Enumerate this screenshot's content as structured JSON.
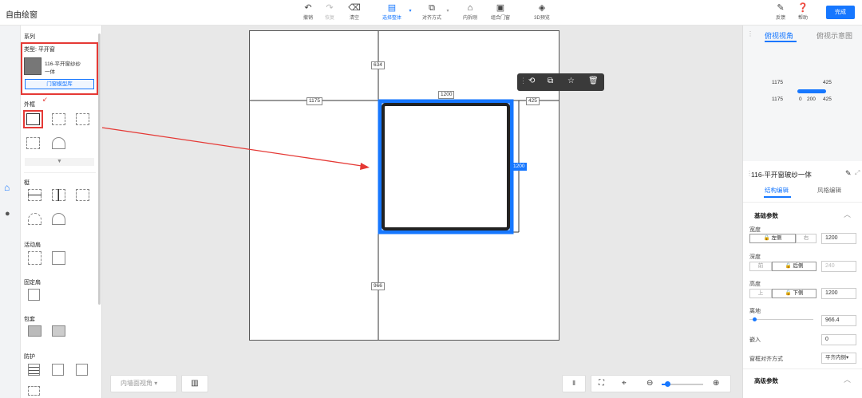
{
  "app": {
    "title": "自由绘窗"
  },
  "toolbar": {
    "undo": "撤销",
    "redo": "恢复",
    "clear": "清空",
    "select_all": "选择整体",
    "align": "对齐方式",
    "inner_split": "内拆刚",
    "combine": "组合门窗",
    "preview3d": "3D预览",
    "feedback": "反馈",
    "help": "帮助",
    "done": "完成"
  },
  "left_panel": {
    "series_title": "系列",
    "type_label": "类型: 平开窗",
    "product_name_1": "116-平开窗纱纱",
    "product_name_2": "一体",
    "library_button": "门窗模型库",
    "section_frame": "外框",
    "section_mullion": "梃",
    "section_active_sash": "活动扇",
    "section_fixed_sash": "固定扇",
    "section_cover": "包套",
    "section_guard": "防护"
  },
  "drawing": {
    "dim_top": "634",
    "dim_left": "1175",
    "dim_width": "1200",
    "dim_right": "425",
    "dim_height": "1200",
    "dim_bottom": "966"
  },
  "canvas_bottom": {
    "view_select": "内墙面视角"
  },
  "right_panel": {
    "tab_top_view": "俯视视角",
    "tab_top_diagram": "俯视示意图",
    "mini_left_1": "1175",
    "mini_right_1": "425",
    "mini_left_2": "1175",
    "mini_mid_0": "0",
    "mini_mid_200": "200",
    "mini_right_2": "425",
    "product_title": "116-平开窗玻纱一体",
    "tab_structure": "结构编辑",
    "tab_style": "风格编辑",
    "basic_params": "基础参数",
    "width_label": "宽度",
    "width_left": "左侧",
    "width_right": "右",
    "width_value": "1200",
    "depth_label": "深度",
    "depth_front": "前",
    "depth_back": "后侧",
    "depth_value": "240",
    "height_label": "高度",
    "height_up": "上",
    "height_down": "下侧",
    "height_value": "1200",
    "ground_label": "离地",
    "ground_value": "966.4",
    "embed_label": "嵌入",
    "embed_value": "0",
    "align_label": "窗框对齐方式",
    "align_value": "平齐内侧",
    "advanced_params": "高级参数"
  },
  "colors": {
    "accent": "#1677ff",
    "annotation": "#e53935"
  },
  "zoom": {
    "level": 0.1
  }
}
